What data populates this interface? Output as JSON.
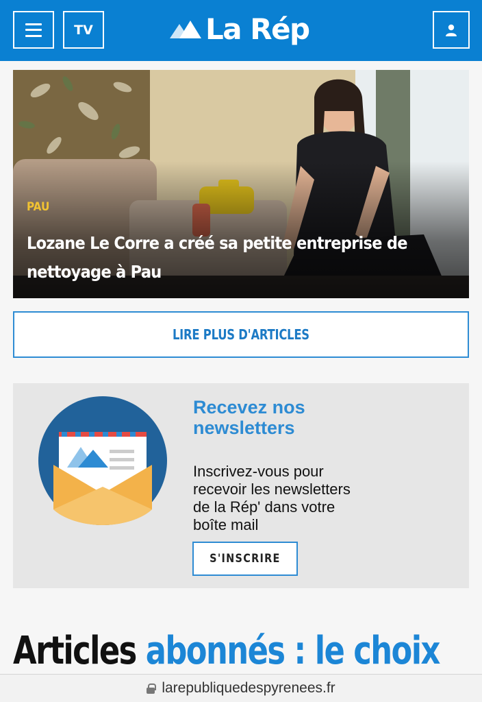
{
  "header": {
    "tv_label": "TV",
    "logo_text": "La Rép",
    "icons": {
      "menu": "hamburger-icon",
      "account": "user-icon",
      "logo": "mountain-logo"
    }
  },
  "hero": {
    "category": "PAU",
    "title": "Lozane Le Corre a créé sa petite entreprise de nettoyage à Pau"
  },
  "more_button": {
    "label": "LIRE PLUS D'ARTICLES"
  },
  "newsletter": {
    "title_line1": "Recevez nos",
    "title_line2": "newsletters",
    "text_line1": "Inscrivez-vous pour",
    "text_line2": "recevoir les newsletters",
    "text_line3": "de la Rép' dans votre",
    "text_line4": "boîte mail",
    "button_label": "S'INSCRIRE",
    "icon": "envelope-icon"
  },
  "section": {
    "heading_black": "Articles",
    "heading_blue": "abonnés : le choix"
  },
  "address_bar": {
    "url": "larepubliquedespyrenees.fr",
    "icon": "lock-icon"
  },
  "colors": {
    "brand_blue": "#0a80d2",
    "accent_blue": "#2d8bd3",
    "category_yellow": "#f1c232"
  }
}
